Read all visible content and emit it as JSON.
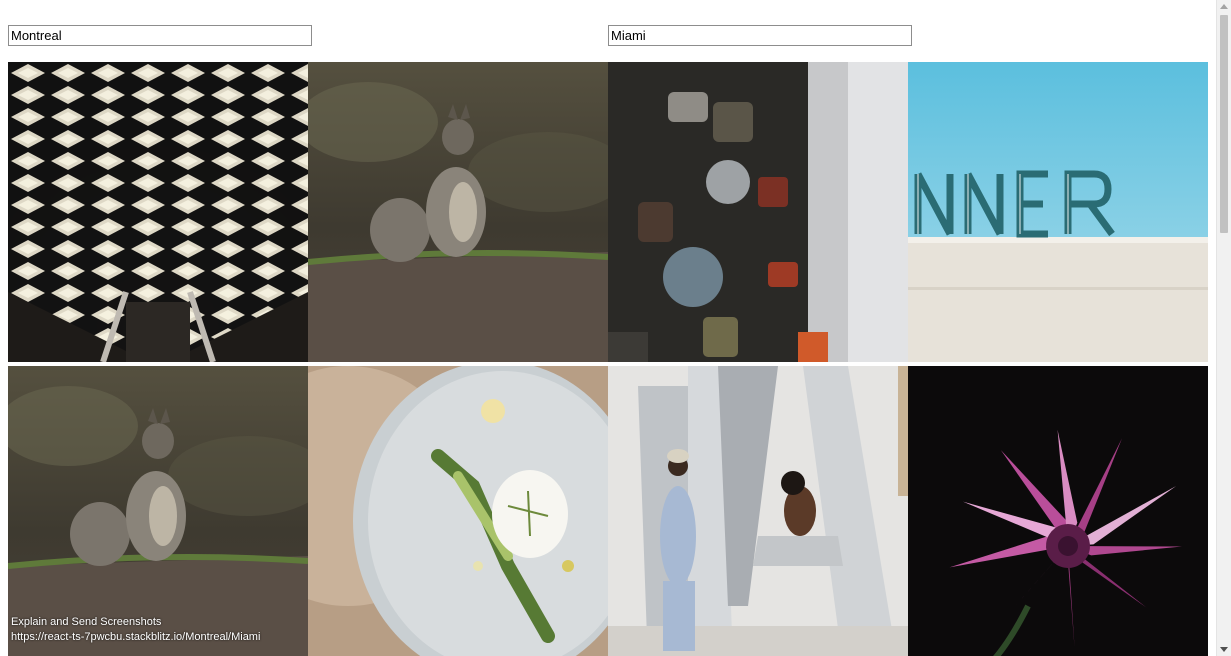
{
  "search": {
    "left": {
      "value": "Montreal",
      "placeholder": ""
    },
    "right": {
      "value": "Miami",
      "placeholder": ""
    }
  },
  "gallery": {
    "photos": [
      {
        "id": "subway-ceiling",
        "subject": "Montreal metro station ceiling"
      },
      {
        "id": "squirrel-1",
        "subject": "Squirrel standing on ground"
      },
      {
        "id": "love-locks",
        "subject": "Padlocks on fence"
      },
      {
        "id": "diner-sign",
        "subject": "Diner sign against blue sky"
      },
      {
        "id": "squirrel-2",
        "subject": "Squirrel standing on ground"
      },
      {
        "id": "egg-plate",
        "subject": "Plated egg dish with asparagus"
      },
      {
        "id": "women-sculpture",
        "subject": "Two women at large letter sculpture"
      },
      {
        "id": "pink-flower",
        "subject": "Pink flower on dark background"
      }
    ]
  },
  "footer": {
    "line1": "Explain and Send Screenshots",
    "line2": "https://react-ts-7pwcbu.stackblitz.io/Montreal/Miami"
  },
  "scrollbar": {
    "position": 0
  }
}
